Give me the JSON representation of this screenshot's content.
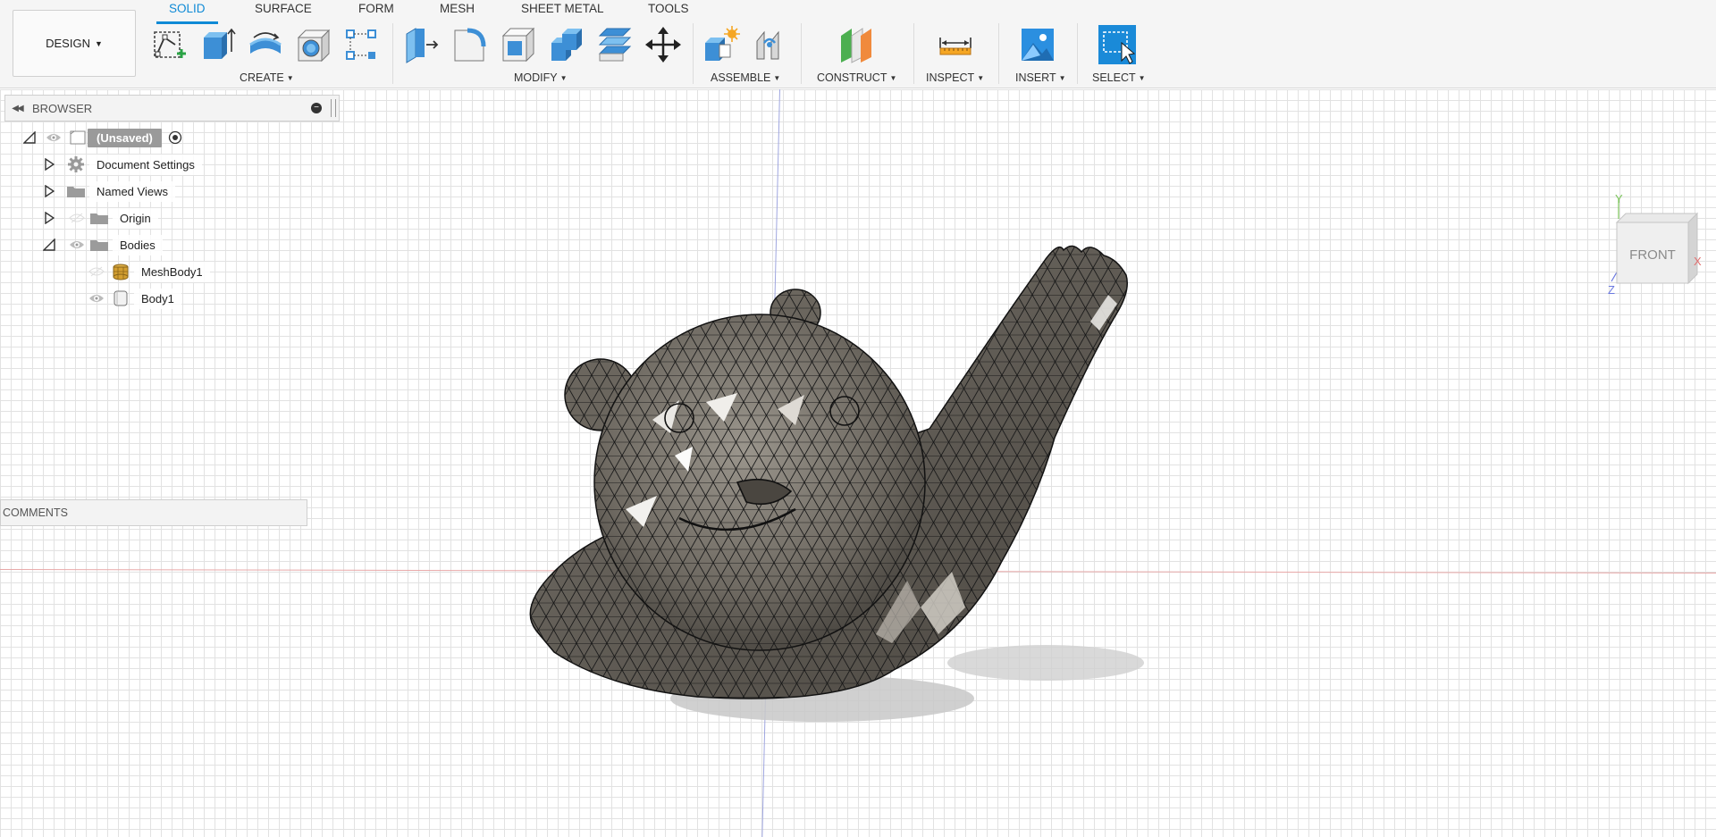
{
  "workspace": {
    "label": "DESIGN"
  },
  "tabs": [
    {
      "label": "SOLID",
      "active": true
    },
    {
      "label": "SURFACE",
      "active": false
    },
    {
      "label": "FORM",
      "active": false
    },
    {
      "label": "MESH",
      "active": false
    },
    {
      "label": "SHEET METAL",
      "active": false
    },
    {
      "label": "TOOLS",
      "active": false
    }
  ],
  "groups": {
    "create": "CREATE",
    "modify": "MODIFY",
    "assemble": "ASSEMBLE",
    "construct": "CONSTRUCT",
    "inspect": "INSPECT",
    "insert": "INSERT",
    "select": "SELECT"
  },
  "tools": {
    "create": [
      "create-sketch-icon",
      "extrude-icon",
      "revolve-icon",
      "hole-icon",
      "pattern-icon"
    ],
    "modify": [
      "press-pull-icon",
      "fillet-icon",
      "shell-icon",
      "combine-icon",
      "offset-face-icon",
      "move-icon"
    ],
    "assemble": [
      "new-component-icon",
      "joint-icon"
    ],
    "construct": [
      "offset-plane-icon"
    ],
    "inspect": [
      "measure-icon"
    ],
    "insert": [
      "insert-image-icon"
    ],
    "select": [
      "select-icon"
    ]
  },
  "browser": {
    "title": "BROWSER",
    "root": "(Unsaved)",
    "items": [
      {
        "label": "Document Settings",
        "icon": "gear-icon"
      },
      {
        "label": "Named Views",
        "icon": "folder-icon"
      },
      {
        "label": "Origin",
        "icon": "folder-icon"
      },
      {
        "label": "Bodies",
        "icon": "folder-icon"
      },
      {
        "label": "MeshBody1",
        "icon": "mesh-body-icon"
      },
      {
        "label": "Body1",
        "icon": "solid-body-icon"
      }
    ]
  },
  "comments": {
    "title": "COMMENTS"
  },
  "viewcube": {
    "face": "FRONT",
    "axis_x": "X",
    "axis_y": "Y",
    "axis_z": "Z"
  },
  "colors": {
    "accent": "#0f8ad6",
    "mesh_fill": "#6e6a62",
    "mesh_edge": "#1a1a1a"
  }
}
